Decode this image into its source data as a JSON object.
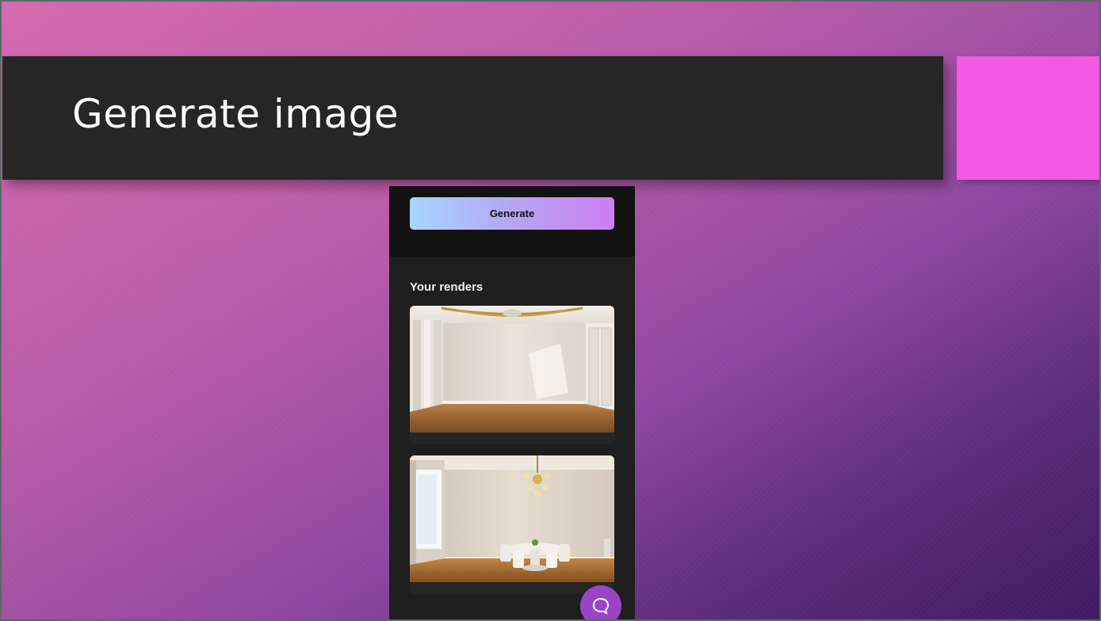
{
  "slide": {
    "title": "Generate image"
  },
  "app": {
    "generate_button_label": "Generate",
    "renders_heading": "Your renders",
    "renders": [
      {
        "kind": "empty-room-render"
      },
      {
        "kind": "dining-room-render"
      }
    ],
    "chat_icon": "chat-bubble-icon"
  },
  "colors": {
    "title_bar": "#262626",
    "accent_block": "#f25ae4",
    "button_gradient_start": "#a6d6ff",
    "button_gradient_end": "#cd7ef2",
    "fab": "#9a45c8"
  }
}
